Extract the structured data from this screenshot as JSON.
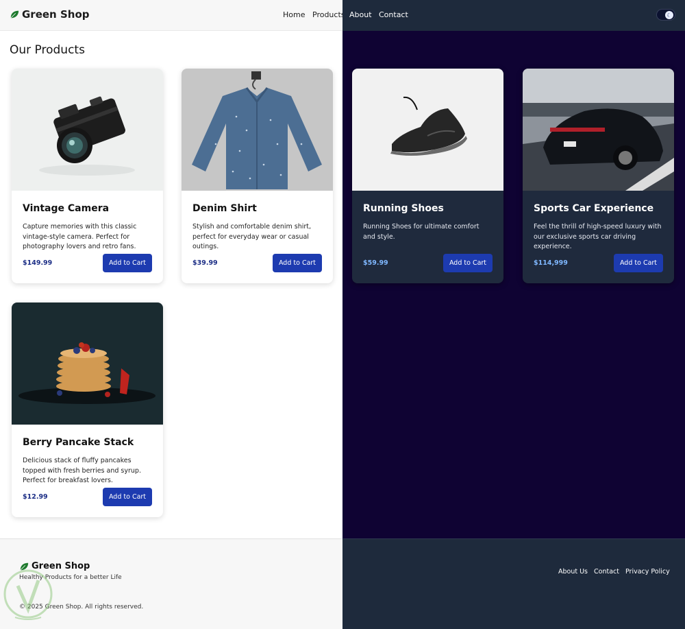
{
  "brand": {
    "name": "Green Shop",
    "leaf_color": "#1e7a2e"
  },
  "nav": {
    "links": [
      "Home",
      "Products",
      "About",
      "Contact"
    ],
    "theme_toggle_icon": "moon-icon"
  },
  "page": {
    "title": "Our Products"
  },
  "products": [
    {
      "name": "Vintage Camera",
      "description": "Capture memories with this classic vintage-style camera. Perfect for photography lovers and retro fans.",
      "price": "$149.99",
      "button": "Add to Cart",
      "image": "camera-photo"
    },
    {
      "name": "Denim Shirt",
      "description": "Stylish and comfortable denim shirt, perfect for everyday wear or casual outings.",
      "price": "$39.99",
      "button": "Add to Cart",
      "image": "denim-shirt-photo"
    },
    {
      "name": "Running Shoes",
      "description": "Running Shoes for ultimate comfort and style.",
      "price": "$59.99",
      "button": "Add to Cart",
      "image": "running-shoe-photo"
    },
    {
      "name": "Sports Car Experience",
      "description": "Feel the thrill of high-speed luxury with our exclusive sports car driving experience.",
      "price": "$114,999",
      "button": "Add to Cart",
      "image": "sports-car-photo"
    },
    {
      "name": "Berry Pancake Stack",
      "description": "Delicious stack of fluffy pancakes topped with fresh berries and syrup. Perfect for breakfast lovers.",
      "price": "$12.99",
      "button": "Add to Cart",
      "image": "pancakes-photo"
    }
  ],
  "footer": {
    "brand": "Green Shop",
    "tagline": "Healthy Products for a better Life",
    "copyright": "© 2025 Green Shop. All rights reserved.",
    "links": [
      "About Us",
      "Contact",
      "Privacy Policy"
    ]
  },
  "colors": {
    "accent_button": "#1d3bb0",
    "dark_bg": "#0f0333",
    "dark_panel": "#1e2a3c",
    "light_price": "#1c2e86",
    "dark_price": "#7fb7ff"
  }
}
